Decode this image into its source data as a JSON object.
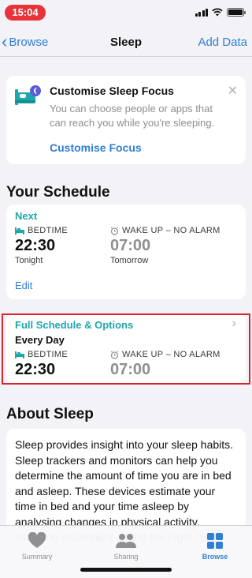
{
  "status_bar": {
    "time": "15:04"
  },
  "nav": {
    "back_label": "Browse",
    "title": "Sleep",
    "action_label": "Add Data"
  },
  "focus_card": {
    "title": "Customise Sleep Focus",
    "description": "You can choose people or apps that can reach you while you're sleeping.",
    "link_label": "Customise Focus",
    "close_glyph": "✕"
  },
  "schedule": {
    "header": "Your Schedule",
    "next_card": {
      "label": "Next",
      "bedtime_label": "BEDTIME",
      "bedtime_value": "22:30",
      "bedtime_day": "Tonight",
      "wake_label": "WAKE UP – NO ALARM",
      "wake_value": "07:00",
      "wake_day": "Tomorrow",
      "edit_label": "Edit"
    },
    "full_card": {
      "label": "Full Schedule & Options",
      "repeat": "Every Day",
      "bedtime_label": "BEDTIME",
      "bedtime_value": "22:30",
      "wake_label": "WAKE UP – NO ALARM",
      "wake_value": "07:00"
    }
  },
  "about": {
    "header": "About Sleep",
    "text": "Sleep provides insight into your sleep habits. Sleep trackers and monitors can help you determine the amount of time you are in bed and asleep. These devices estimate your time in bed and your time asleep by analysing changes in physical activity, including movement during the night. You"
  },
  "tab_bar": {
    "tabs": [
      {
        "label": "Summary",
        "icon": "heart-icon"
      },
      {
        "label": "Sharing",
        "icon": "people-icon"
      },
      {
        "label": "Browse",
        "icon": "grid-icon"
      }
    ],
    "active": "Browse"
  },
  "colors": {
    "accent_blue": "#2f7fd4",
    "teal": "#1ea7ab",
    "time_pill_red": "#e8333a",
    "highlight_red": "#d9232d"
  }
}
